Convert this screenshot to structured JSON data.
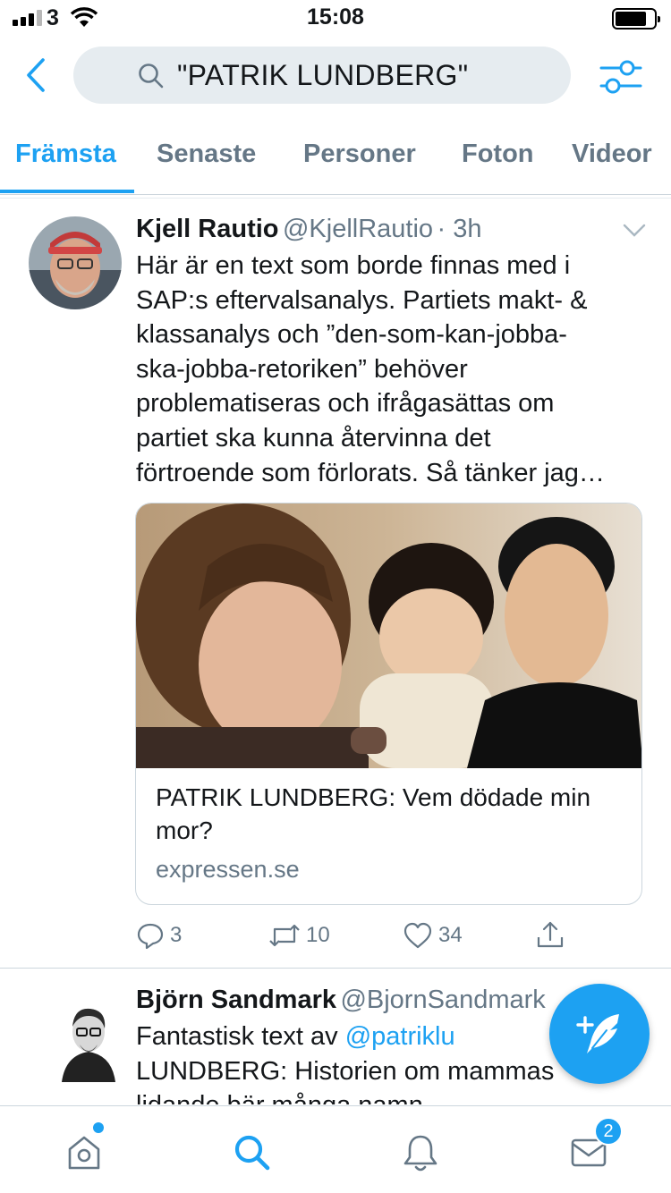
{
  "status_bar": {
    "carrier": "3",
    "time": "15:08"
  },
  "search": {
    "query": "\"PATRIK LUNDBERG\""
  },
  "tabs": [
    {
      "label": "Främsta",
      "active": true
    },
    {
      "label": "Senaste",
      "active": false
    },
    {
      "label": "Personer",
      "active": false
    },
    {
      "label": "Foton",
      "active": false
    },
    {
      "label": "Videor",
      "active": false
    }
  ],
  "tweets": [
    {
      "name": "Kjell Rautio",
      "handle": "@KjellRautio",
      "time": "· 3h",
      "text_lines": [
        "Här är en text som borde finnas med i",
        "SAP:s eftervalsanalys. Partiets makt- &",
        "klassanalys och ”den-som-kan-jobba-",
        "ska-jobba-retoriken” behöver",
        "problematiseras och ifrågasättas om",
        "partiet ska kunna återvinna det",
        "förtroende som förlorats. Så tänker jag…"
      ],
      "card": {
        "title": "PATRIK LUNDBERG: Vem dödade min mor?",
        "domain": "expressen.se"
      },
      "actions": {
        "replies": "3",
        "retweets": "10",
        "likes": "34"
      }
    },
    {
      "name": "Björn Sandmark",
      "handle": "@BjornSandmark",
      "text_prefix": "Fantastisk text av ",
      "mention": "@patriklu",
      "text_lines": [
        "LUNDBERG: Historien om mammas",
        "lidande bär många namn"
      ]
    }
  ],
  "tabbar": {
    "messages_badge": "2"
  },
  "colors": {
    "accent": "#1da1f2",
    "secondary_text": "#657786",
    "divider": "#ccd6dd"
  }
}
